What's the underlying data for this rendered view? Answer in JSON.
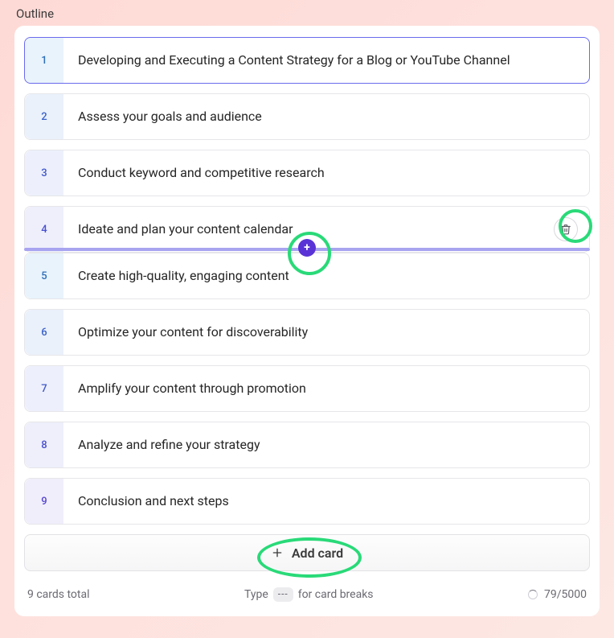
{
  "page": {
    "title": "Outline"
  },
  "cards": [
    {
      "num": "1",
      "text": "Developing and Executing a Content Strategy for a Blog or YouTube Channel"
    },
    {
      "num": "2",
      "text": "Assess your goals and audience"
    },
    {
      "num": "3",
      "text": "Conduct keyword and competitive research"
    },
    {
      "num": "4",
      "text": "Ideate and plan your content calendar"
    },
    {
      "num": "5",
      "text": "Create high-quality, engaging content"
    },
    {
      "num": "6",
      "text": "Optimize your content for discoverability"
    },
    {
      "num": "7",
      "text": "Amplify your content through promotion"
    },
    {
      "num": "8",
      "text": "Analyze and refine your strategy"
    },
    {
      "num": "9",
      "text": "Conclusion and next steps"
    }
  ],
  "addCard": {
    "label": "Add card"
  },
  "footer": {
    "totalLabel": "9 cards total",
    "hintPrefix": "Type",
    "hintKey": "---",
    "hintSuffix": "for card breaks",
    "counter": "79/5000"
  }
}
